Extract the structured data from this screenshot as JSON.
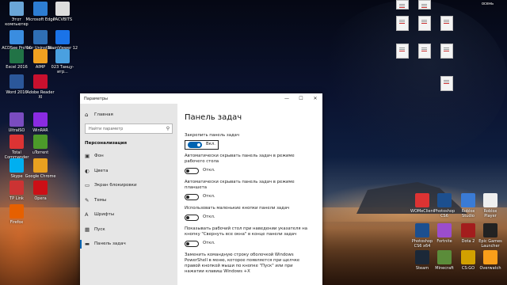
{
  "desktop": {
    "icons_left": [
      {
        "label": "Этот компьютер",
        "color": "#6aa6d8"
      },
      {
        "label": "Microsoft Edge",
        "color": "#2d7dd2"
      },
      {
        "label": "PACVBITS",
        "color": "#ddd"
      },
      {
        "label": "ACDSee Pro 10",
        "color": "#3a8de0"
      },
      {
        "label": "Your Uninstall...",
        "color": "#2f6fb5"
      },
      {
        "label": "TeamViewer 12",
        "color": "#1a73e8"
      },
      {
        "label": "Excel 2016",
        "color": "#217346"
      },
      {
        "label": "AIMP",
        "color": "#f0a020"
      },
      {
        "label": "023 Танцу-игр...",
        "color": "#4aa0e0"
      },
      {
        "label": "Word 2016",
        "color": "#2b579a"
      },
      {
        "label": "Adobe Reader XI",
        "color": "#c8102e"
      },
      {
        "label": "UltraISO",
        "color": "#7a4cc0"
      },
      {
        "label": "WinRAR",
        "color": "#8a2be2"
      },
      {
        "label": "Total Commander",
        "color": "#d33"
      },
      {
        "label": "uTorrent",
        "color": "#4c9a2a"
      },
      {
        "label": "Skype",
        "color": "#00aff0"
      },
      {
        "label": "Google Chrome",
        "color": "#e8a020"
      },
      {
        "label": "TP Link",
        "color": "#c33"
      },
      {
        "label": "Opera",
        "color": "#cc0f16"
      },
      {
        "label": "Firefox",
        "color": "#e66000"
      }
    ],
    "icons_right": [
      {
        "label": "WOMeClient",
        "color": "#d33"
      },
      {
        "label": "Photoshop CS6",
        "color": "#1c4f8f"
      },
      {
        "label": "Roblox Studio",
        "color": "#3a7bd5"
      },
      {
        "label": "Roblox Player",
        "color": "#eee"
      },
      {
        "label": "Photoshop CS6 x64",
        "color": "#1c4f8f"
      },
      {
        "label": "Fortnite",
        "color": "#9b4dcc"
      },
      {
        "label": "Dota 2",
        "color": "#a31d1d"
      },
      {
        "label": "Epic Games Launcher",
        "color": "#222"
      },
      {
        "label": "Steam",
        "color": "#1b2838"
      },
      {
        "label": "Minecraft",
        "color": "#5b8c3a"
      },
      {
        "label": "CS:GO",
        "color": "#d2a000"
      },
      {
        "label": "Overwatch",
        "color": "#f99e1a"
      }
    ],
    "top_right_label": "осень"
  },
  "window": {
    "title": "Параметры",
    "minimize": "—",
    "maximize": "☐",
    "close": "✕"
  },
  "sidebar": {
    "home": "Главная",
    "search_placeholder": "Найти параметр",
    "section": "Персонализация",
    "items": [
      {
        "label": "Фон",
        "icon": "image-icon",
        "glyph": "▣"
      },
      {
        "label": "Цвета",
        "icon": "palette-icon",
        "glyph": "◐"
      },
      {
        "label": "Экран блокировки",
        "icon": "lock-screen-icon",
        "glyph": "▭"
      },
      {
        "label": "Темы",
        "icon": "brush-icon",
        "glyph": "✎"
      },
      {
        "label": "Шрифты",
        "icon": "font-icon",
        "glyph": "A"
      },
      {
        "label": "Пуск",
        "icon": "start-icon",
        "glyph": "▦"
      },
      {
        "label": "Панель задач",
        "icon": "taskbar-icon",
        "glyph": "▬"
      }
    ],
    "active_index": 6
  },
  "main": {
    "title": "Панель задач",
    "settings": [
      {
        "label": "Закрепить панель задач",
        "on": true,
        "state": "Вкл."
      },
      {
        "label": "Автоматически скрывать панель задач в режиме рабочего стола",
        "on": false,
        "state": "Откл."
      },
      {
        "label": "Автоматически скрывать панель задач в режиме планшета",
        "on": false,
        "state": "Откл."
      },
      {
        "label": "Использовать маленькие кнопки панели задач",
        "on": false,
        "state": "Откл."
      },
      {
        "label": "Показывать рабочий стол при наведении указателя на кнопку \"Свернуть все окна\" в конце панели задач",
        "on": false,
        "state": "Откл."
      },
      {
        "label": "Заменить командную строку оболочкой Windows PowerShell в меню, которое появляется при щелчке правой кнопкой мыши по кнопке \"Пуск\" или при нажатии клавиш Windows +X",
        "on": null,
        "state": ""
      }
    ]
  }
}
